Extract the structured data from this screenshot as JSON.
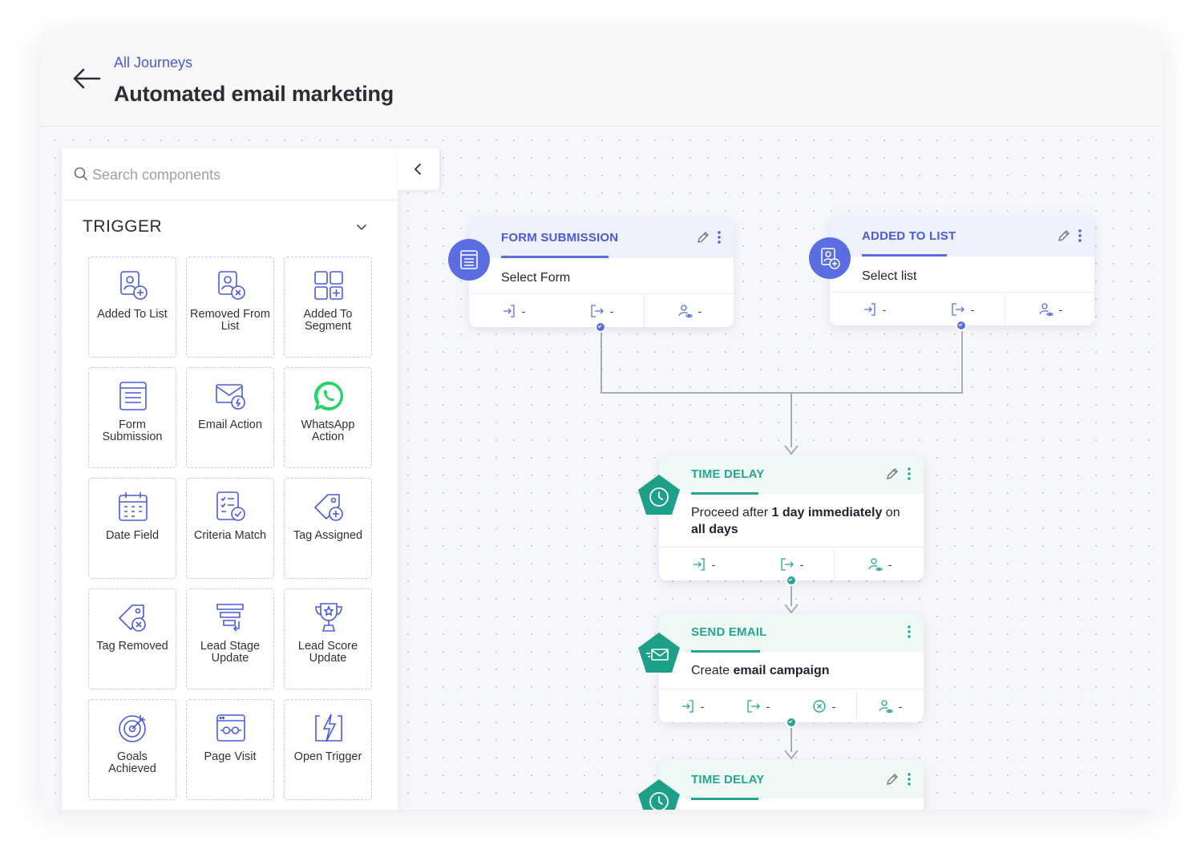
{
  "header": {
    "breadcrumb": "All Journeys",
    "title": "Automated email marketing"
  },
  "search": {
    "placeholder": "Search components"
  },
  "panel": {
    "section": "TRIGGER",
    "tiles": [
      {
        "label": "Added To List",
        "icon": "added-to-list-icon"
      },
      {
        "label": "Removed From List",
        "icon": "removed-from-list-icon"
      },
      {
        "label": "Added To Segment",
        "icon": "added-to-segment-icon"
      },
      {
        "label": "Form Submission",
        "icon": "form-submission-icon"
      },
      {
        "label": "Email Action",
        "icon": "email-action-icon"
      },
      {
        "label": "WhatsApp Action",
        "icon": "whatsapp-icon"
      },
      {
        "label": "Date Field",
        "icon": "calendar-icon"
      },
      {
        "label": "Criteria Match",
        "icon": "criteria-match-icon"
      },
      {
        "label": "Tag Assigned",
        "icon": "tag-assigned-icon"
      },
      {
        "label": "Tag Removed",
        "icon": "tag-removed-icon"
      },
      {
        "label": "Lead Stage Update",
        "icon": "lead-stage-icon"
      },
      {
        "label": "Lead Score Update",
        "icon": "trophy-icon"
      },
      {
        "label": "Goals Achieved",
        "icon": "target-icon"
      },
      {
        "label": "Page Visit",
        "icon": "page-visit-icon"
      },
      {
        "label": "Open Trigger",
        "icon": "lightning-icon"
      }
    ]
  },
  "nodes": {
    "form_submission": {
      "title": "FORM SUBMISSION",
      "body": "Select Form",
      "stat_in": "-",
      "stat_out": "-",
      "stat_contacts": "-"
    },
    "added_to_list": {
      "title": "ADDED TO LIST",
      "body": "Select list",
      "stat_in": "-",
      "stat_out": "-",
      "stat_contacts": "-"
    },
    "time_delay_1": {
      "title": "TIME DELAY",
      "body_prefix": "Proceed after ",
      "body_bold1": "1 day immediately",
      "body_mid": " on ",
      "body_bold2": "all days",
      "stat_in": "-",
      "stat_out": "-",
      "stat_contacts": "-"
    },
    "send_email": {
      "title": "SEND EMAIL",
      "body_prefix": "Create ",
      "body_bold": "email campaign",
      "stat_in": "-",
      "stat_out": "-",
      "stat_failed": "-",
      "stat_contacts": "-"
    },
    "time_delay_2": {
      "title": "TIME DELAY"
    }
  },
  "colors": {
    "trigger": "#5b6ee1",
    "action": "#26a692",
    "trigger_head": "#eff1fc",
    "action_head": "#eef8f5",
    "link": "#4a5ad6"
  }
}
